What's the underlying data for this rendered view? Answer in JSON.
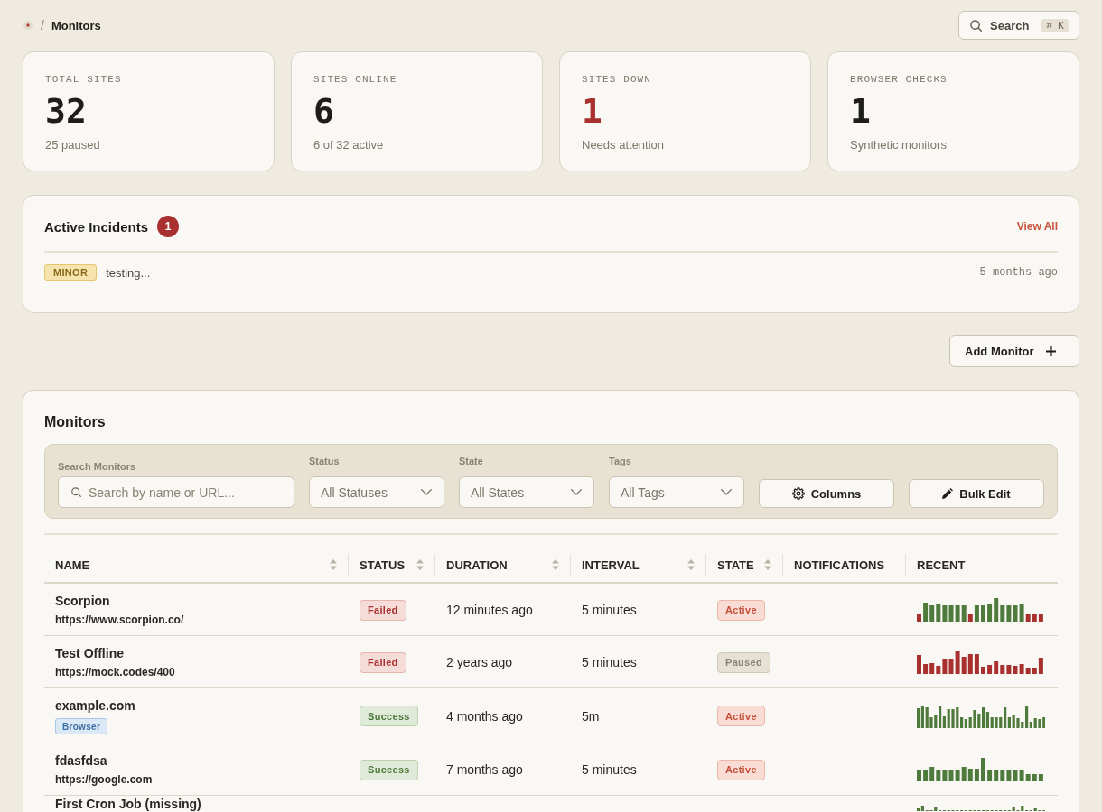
{
  "breadcrumb": {
    "separator": "/",
    "current": "Monitors"
  },
  "search_button": {
    "label": "Search",
    "shortcut": "⌘ K"
  },
  "stats": [
    {
      "label": "TOTAL SITES",
      "value": "32",
      "note": "25 paused",
      "alert": false
    },
    {
      "label": "SITES ONLINE",
      "value": "6",
      "note": "6 of 32 active",
      "alert": false
    },
    {
      "label": "SITES DOWN",
      "value": "1",
      "note": "Needs attention",
      "alert": true
    },
    {
      "label": "BROWSER CHECKS",
      "value": "1",
      "note": "Synthetic monitors",
      "alert": false
    }
  ],
  "incidents": {
    "title": "Active Incidents",
    "count": "1",
    "view_all": "View All",
    "items": [
      {
        "severity": "MINOR",
        "kind": "minor",
        "title": "testing...",
        "time": "5 months ago"
      }
    ]
  },
  "add_monitor_button": {
    "label": "Add Monitor"
  },
  "monitors": {
    "title": "Monitors",
    "filters": {
      "search": {
        "label": "Search Monitors",
        "placeholder": "Search by name or URL..."
      },
      "dropdowns": [
        {
          "label": "Status",
          "value": "All Statuses"
        },
        {
          "label": "State",
          "value": "All States"
        },
        {
          "label": "Tags",
          "value": "All Tags"
        }
      ],
      "buttons": [
        {
          "label": "Columns",
          "kind": "columns"
        },
        {
          "label": "Bulk Edit",
          "kind": "edit"
        }
      ]
    },
    "table": {
      "columns": [
        {
          "label": "NAME",
          "sortable": true
        },
        {
          "label": "STATUS",
          "sortable": true
        },
        {
          "label": "DURATION",
          "sortable": true
        },
        {
          "label": "INTERVAL",
          "sortable": true
        },
        {
          "label": "STATE",
          "sortable": true
        },
        {
          "label": "NOTIFICATIONS",
          "sortable": false
        },
        {
          "label": "RECENT",
          "sortable": false
        }
      ],
      "rows": [
        {
          "name": "Scorpion",
          "url": "https://www.scorpion.co/",
          "status": {
            "label": "Failed",
            "kind": "failed"
          },
          "duration": "12 minutes ago",
          "interval": "5 minutes",
          "state": {
            "label": "Active",
            "kind": "active"
          }
        },
        {
          "name": "Test Offline",
          "url": "https://mock.codes/400",
          "status": {
            "label": "Failed",
            "kind": "failed"
          },
          "duration": "2 years ago",
          "interval": "5 minutes",
          "state": {
            "label": "Paused",
            "kind": "paused"
          }
        },
        {
          "name": "example.com",
          "tag": {
            "label": "Browser",
            "kind": "browser"
          },
          "status": {
            "label": "Success",
            "kind": "success"
          },
          "duration": "4 months ago",
          "interval": "5m",
          "state": {
            "label": "Active",
            "kind": "active"
          }
        },
        {
          "name": "fdasfdsa",
          "url": "https://google.com",
          "status": {
            "label": "Success",
            "kind": "success"
          },
          "duration": "7 months ago",
          "interval": "5 minutes",
          "state": {
            "label": "Active",
            "kind": "active"
          }
        },
        {
          "name": "First Cron Job (missing)"
        }
      ]
    }
  }
}
